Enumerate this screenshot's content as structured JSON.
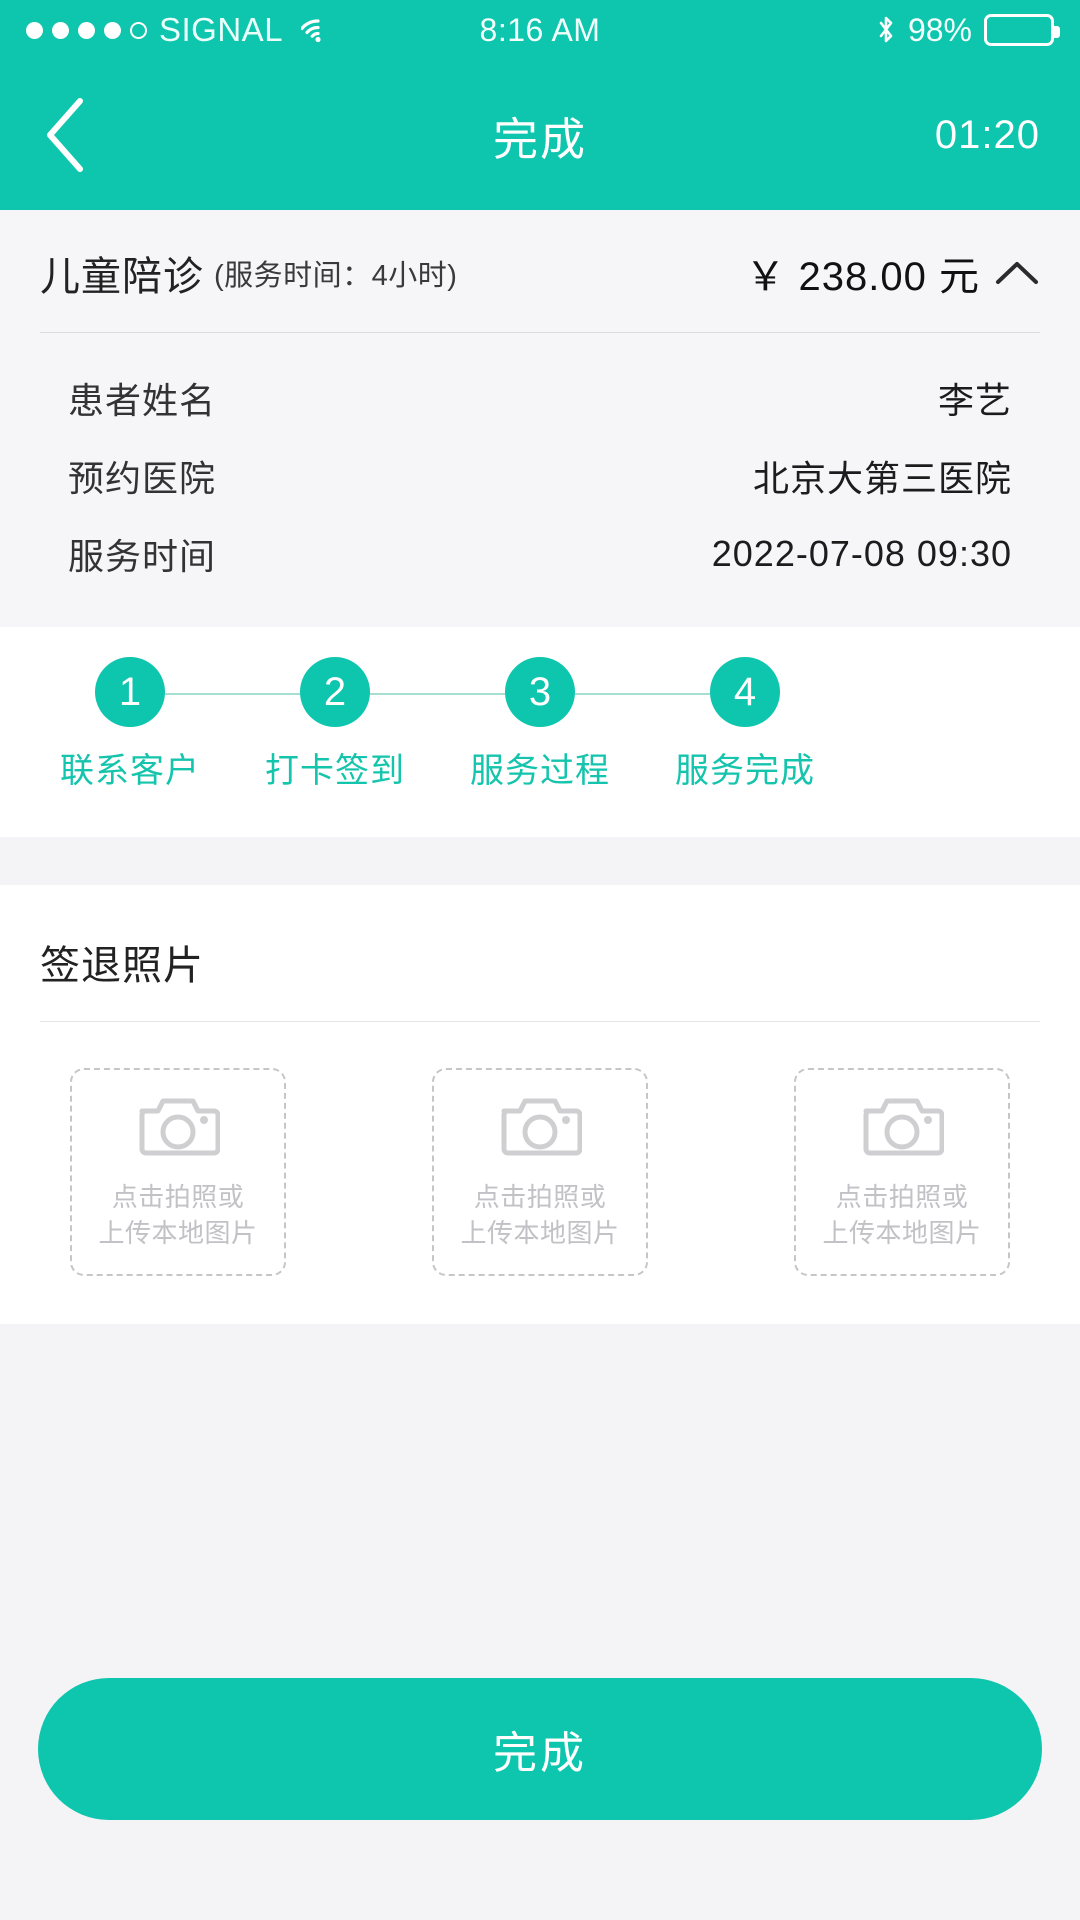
{
  "status_bar": {
    "carrier": "SIGNAL",
    "signal_dots_total": 5,
    "signal_dots_filled": 4,
    "wifi_icon": "wifi-icon",
    "time": "8:16 AM",
    "bluetooth_icon": "bluetooth-icon",
    "battery_percent": "98%",
    "battery_level": 98
  },
  "nav": {
    "back_icon": "chevron-left-icon",
    "title": "完成",
    "timer": "01:20"
  },
  "order": {
    "service_name": "儿童陪诊",
    "service_duration": "(服务时间：4小时)",
    "price": "￥ 238.00 元",
    "collapse_icon": "chevron-up-icon",
    "rows": [
      {
        "label": "患者姓名",
        "value": "李艺"
      },
      {
        "label": "预约医院",
        "value": "北京大第三医院"
      },
      {
        "label": "服务时间",
        "value": "2022-07-08 09:30"
      }
    ]
  },
  "stepper": {
    "steps": [
      {
        "number": "1",
        "label": "联系客户"
      },
      {
        "number": "2",
        "label": "打卡签到"
      },
      {
        "number": "3",
        "label": "服务过程"
      },
      {
        "number": "4",
        "label": "服务完成"
      }
    ]
  },
  "photos": {
    "section_title": "签退照片",
    "slots": [
      {
        "icon": "camera-icon",
        "line1": "点击拍照或",
        "line2": "上传本地图片"
      },
      {
        "icon": "camera-icon",
        "line1": "点击拍照或",
        "line2": "上传本地图片"
      },
      {
        "icon": "camera-icon",
        "line1": "点击拍照或",
        "line2": "上传本地图片"
      }
    ]
  },
  "footer": {
    "submit_label": "完成"
  },
  "colors": {
    "brand": "#0ec5ae",
    "brand_text": "#14c4ac",
    "line": "#a7ded4",
    "page_bg": "#f4f4f6",
    "card_bg": "#f6f6f8",
    "placeholder": "#c2c2c6"
  }
}
